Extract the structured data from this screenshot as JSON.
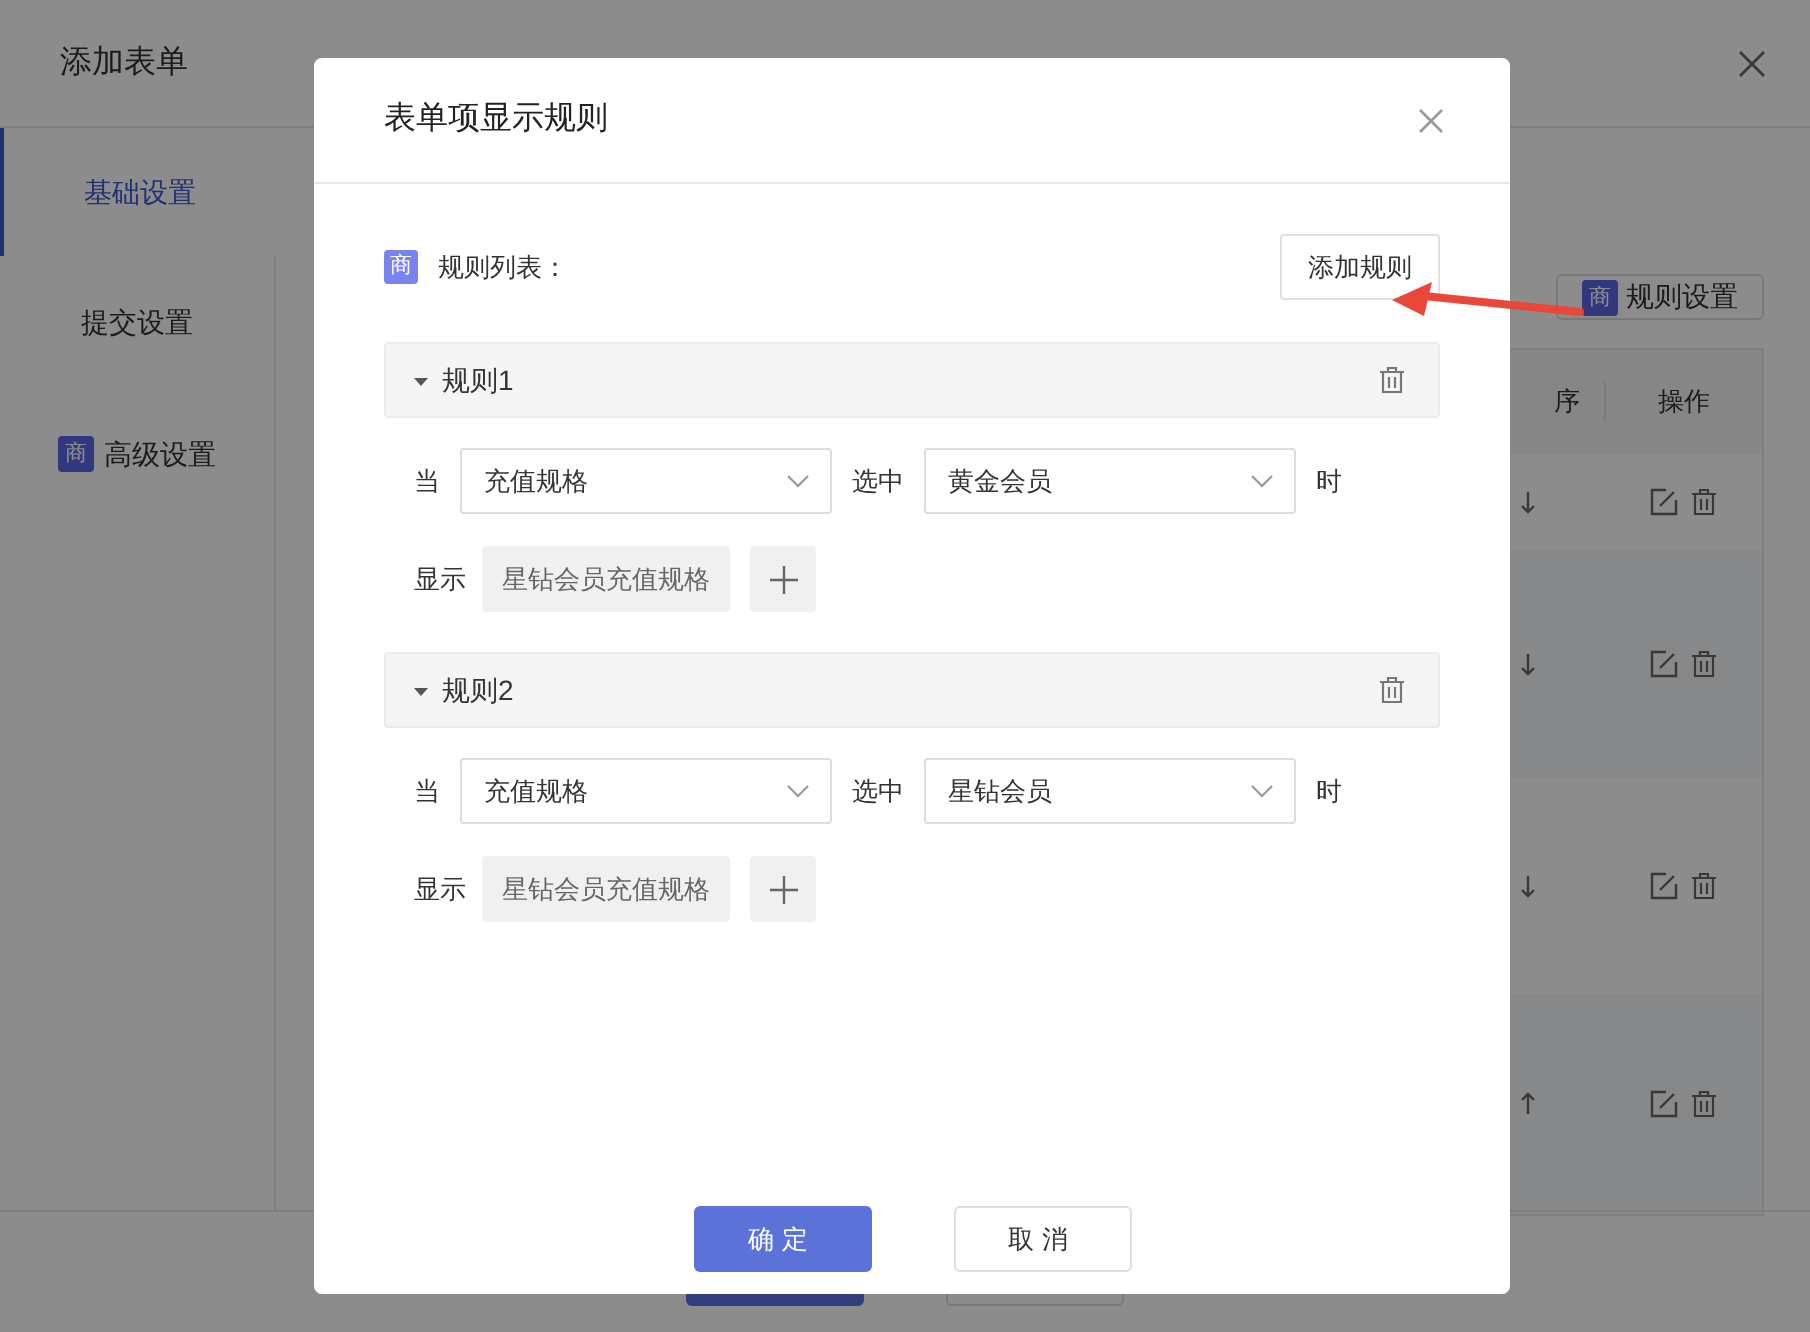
{
  "page": {
    "title": "添加表单",
    "tabs": [
      {
        "label": "基础设置",
        "selected": true
      },
      {
        "label": "提交设置",
        "selected": false
      },
      {
        "label": "高级设置",
        "selected": false,
        "badge": "商"
      }
    ],
    "rule_settings_button": {
      "badge": "商",
      "label": "规则设置"
    },
    "table": {
      "columns": [
        "序",
        "操作"
      ],
      "rows": [
        {
          "kind": "down"
        },
        {
          "kind": "down"
        },
        {
          "kind": "down"
        },
        {
          "kind": "up"
        }
      ]
    }
  },
  "dialog": {
    "title": "表单项显示规则",
    "list_badge": "商",
    "list_label": "规则列表：",
    "add_button": "添加规则",
    "rules": [
      {
        "title": "规则1",
        "expanded": true,
        "when_label": "当",
        "field": "充值规格",
        "selected_label": "选中",
        "value": "黄金会员",
        "then_label": "时",
        "show_label": "显示",
        "shown_fields": [
          "星钻会员充值规格"
        ]
      },
      {
        "title": "规则2",
        "expanded": true,
        "when_label": "当",
        "field": "充值规格",
        "selected_label": "选中",
        "value": "星钻会员",
        "then_label": "时",
        "show_label": "显示",
        "shown_fields": [
          "星钻会员充值规格"
        ]
      }
    ],
    "ok_button": "确定",
    "cancel_button": "取消"
  }
}
